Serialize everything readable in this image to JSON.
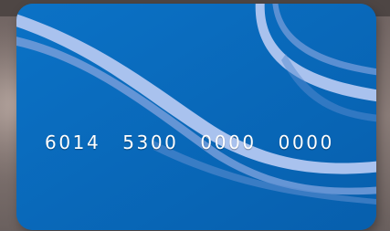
{
  "card": {
    "number": "6014  5300  0000  0000"
  },
  "colors": {
    "card_blue": "#0a6dbf",
    "swoosh_light": "#a9c2ee",
    "swoosh_faint": "#6f9ad8",
    "background": "#7a6a66"
  }
}
